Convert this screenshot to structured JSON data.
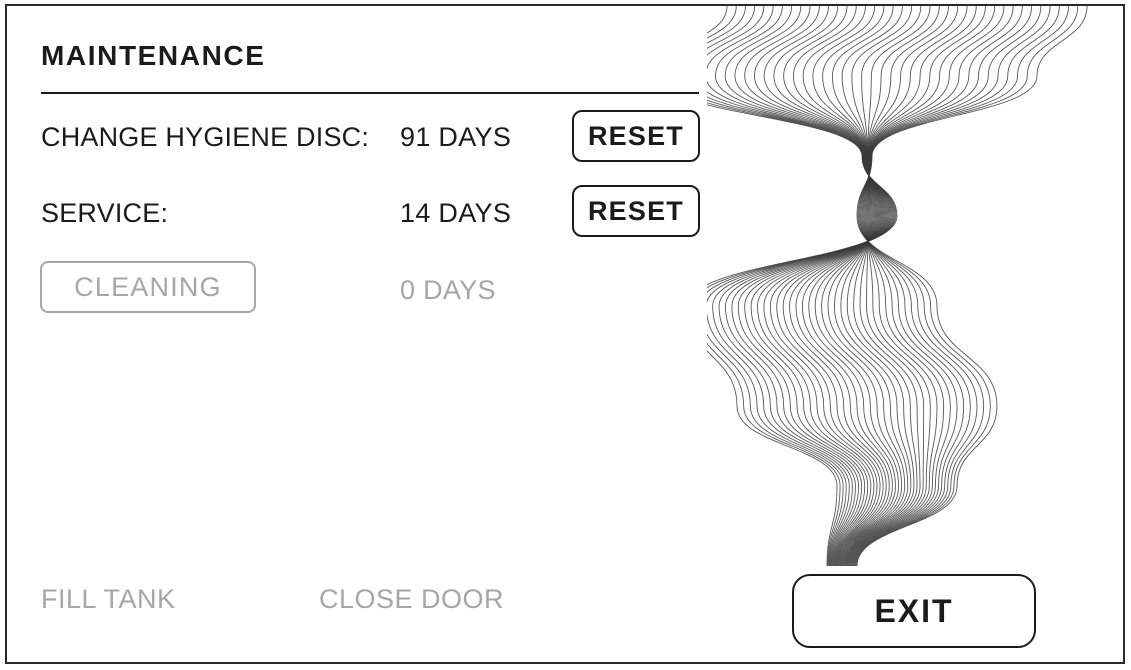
{
  "screen": {
    "title": "MAINTENANCE"
  },
  "rows": [
    {
      "label": "CHANGE HYGIENE DISC:",
      "value": "91 DAYS",
      "action": "RESET"
    },
    {
      "label": "SERVICE:",
      "value": "14 DAYS",
      "action": "RESET"
    },
    {
      "label": "CLEANING",
      "value": "0 DAYS"
    }
  ],
  "footer": {
    "fill_tank": "FILL TANK",
    "close_door": "CLOSE DOOR",
    "exit_label": "EXIT"
  },
  "colors": {
    "text": "#1b1b1b",
    "muted": "#a6a6a6",
    "background": "#ffffff",
    "wave_line": "#3a3a3a"
  },
  "decoration": {
    "icon": "wave-lines-graphic"
  }
}
